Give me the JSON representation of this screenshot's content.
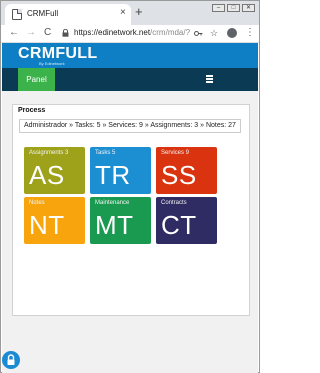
{
  "browser": {
    "tab_title": "CRMFull",
    "tab_close": "×",
    "new_tab": "+",
    "url_main": "https://edinetwork.net",
    "url_rest": "/crm/mda/?",
    "back": "←",
    "forward": "→",
    "reload": "C",
    "star": "☆",
    "menu": "⋮",
    "window_controls": [
      "–",
      "□",
      "✕"
    ]
  },
  "app": {
    "brand": "CRMFULL",
    "brand_sub": "By Edinetwork",
    "panel_label": "Panel"
  },
  "process": {
    "title": "Process",
    "breadcrumb": "Administrador » Tasks: 5 » Services: 9 » Assignments: 3 » Notes: 27"
  },
  "tiles": [
    {
      "label": "Assignments 3",
      "abbr": "AS",
      "color": "#9ea11a"
    },
    {
      "label": "Tasks 5",
      "abbr": "TR",
      "color": "#1b8fd1"
    },
    {
      "label": "Services 9",
      "abbr": "SS",
      "color": "#d9340f"
    },
    {
      "label": "Notes",
      "abbr": "NT",
      "color": "#f7a40d"
    },
    {
      "label": "Maintenance",
      "abbr": "MT",
      "color": "#1a9a50"
    },
    {
      "label": "Contracts",
      "abbr": "CT",
      "color": "#2f2c63"
    }
  ],
  "icons": {
    "tab_favicon": "page-icon",
    "lock": "lock-icon",
    "hamburger": "hamburger-menu-icon",
    "bottom": "padlock-icon"
  }
}
